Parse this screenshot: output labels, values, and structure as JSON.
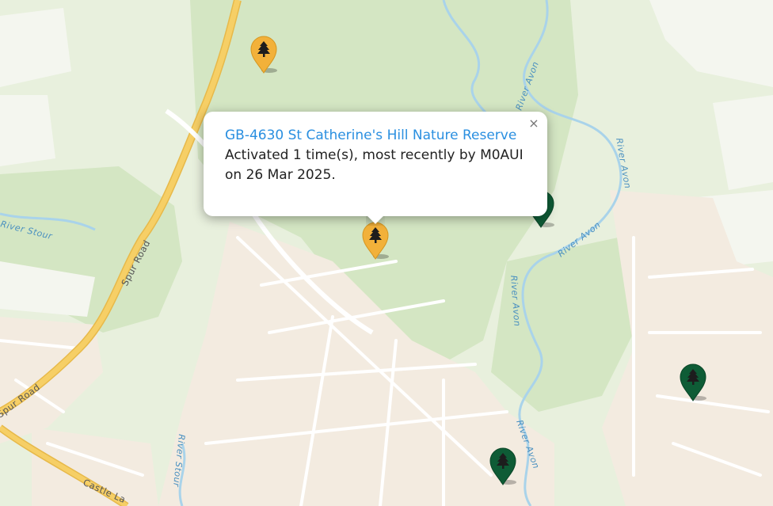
{
  "map": {
    "road_labels": [
      "Spur Road",
      "Spur Road",
      "Castle La"
    ],
    "river_labels": [
      "River Avon",
      "River Avon",
      "River Avon",
      "River Avon",
      "River Avon",
      "River Stour",
      "River Stour"
    ]
  },
  "markers": [
    {
      "name": "marker-yellow-top",
      "color": "#f2b13a",
      "icon": "tree-icon"
    },
    {
      "name": "marker-yellow-selected",
      "color": "#f2b13a",
      "icon": "tree-icon"
    },
    {
      "name": "marker-green-behind-popup",
      "color": "#0e5c36",
      "icon": "tree-icon"
    },
    {
      "name": "marker-green-right",
      "color": "#0e5c36",
      "icon": "tree-icon"
    },
    {
      "name": "marker-green-bottom",
      "color": "#0e5c36",
      "icon": "tree-icon"
    }
  ],
  "popup": {
    "title_link": "GB-4630 St Catherine's Hill Nature Reserve",
    "text": "Activated 1 time(s), most recently by M0AUI on 26 Mar 2025.",
    "close_symbol": "×"
  },
  "colors": {
    "park_green": "#d6e8c6",
    "urban": "#f3ede3",
    "water": "#a9d3ea",
    "major_road": "#f6cf66",
    "popup_link": "#2a8fe0"
  }
}
